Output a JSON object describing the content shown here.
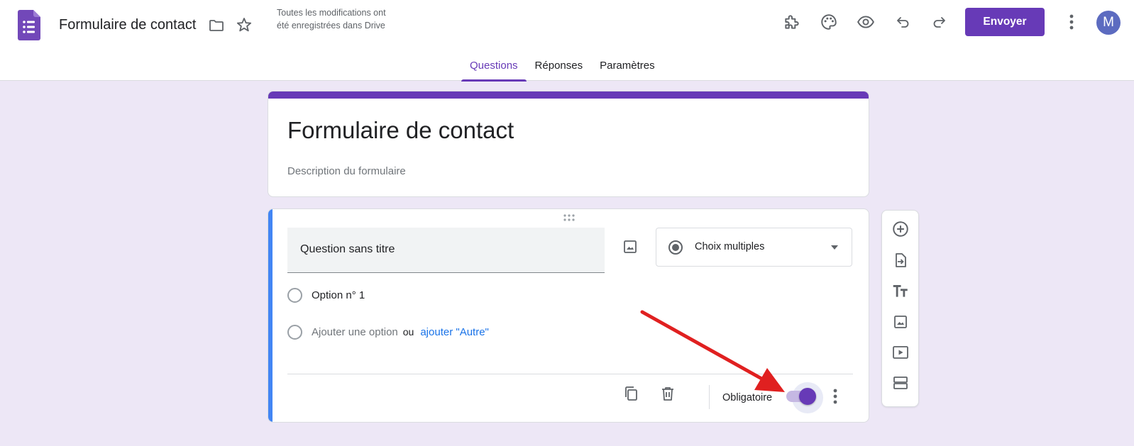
{
  "app": {
    "doc_title": "Formulaire de contact",
    "save_status": "Toutes les modifications ont été enregistrées dans Drive",
    "send_label": "Envoyer",
    "avatar_initial": "M",
    "brand_color": "#673ab7"
  },
  "toolbar_icons": [
    "puzzle-icon",
    "palette-icon",
    "eye-icon",
    "undo-icon",
    "redo-icon",
    "more-vert-icon"
  ],
  "tabs": [
    {
      "label": "Questions",
      "active": true
    },
    {
      "label": "Réponses",
      "active": false
    },
    {
      "label": "Paramètres",
      "active": false
    }
  ],
  "form": {
    "title": "Formulaire de contact",
    "description_placeholder": "Description du formulaire"
  },
  "question": {
    "title": "Question sans titre",
    "type": "Choix multiples",
    "options": [
      {
        "label": "Option n° 1"
      }
    ],
    "add_option": "Ajouter une option",
    "or_text": "ou",
    "add_other": "ajouter \"Autre\"",
    "required_label": "Obligatoire",
    "required": true
  },
  "side_toolbar": [
    "add-question-icon",
    "import-questions-icon",
    "add-title-icon",
    "add-image-icon",
    "add-video-icon",
    "add-section-icon"
  ],
  "annotation": {
    "color": "#e02020"
  }
}
